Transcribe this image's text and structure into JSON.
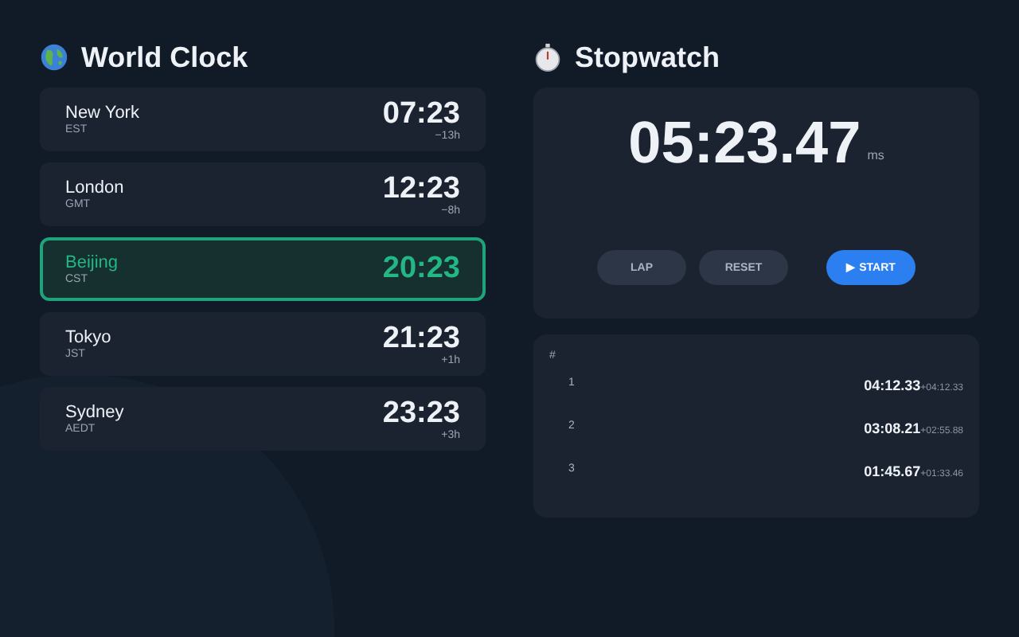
{
  "world_clock": {
    "title": "World Clock",
    "cities": [
      {
        "name": "New York",
        "zone": "EST",
        "time": "07:23",
        "offset": "−13h",
        "selected": false
      },
      {
        "name": "London",
        "zone": "GMT",
        "time": "12:23",
        "offset": "−8h",
        "selected": false
      },
      {
        "name": "Beijing",
        "zone": "CST",
        "time": "20:23",
        "selected": true
      },
      {
        "name": "Tokyo",
        "zone": "JST",
        "time": "21:23",
        "offset": "+1h",
        "selected": false
      },
      {
        "name": "Sydney",
        "zone": "AEDT",
        "time": "23:23",
        "offset": "+3h",
        "selected": false
      }
    ]
  },
  "stopwatch": {
    "title": "Stopwatch",
    "time": "05:23.47",
    "unit": "ms",
    "buttons": [
      {
        "label": "LAP",
        "kind": "secondary"
      },
      {
        "label": "RESET",
        "kind": "secondary"
      },
      {
        "label": "START",
        "kind": "primary",
        "icon": "▶"
      }
    ]
  },
  "laps": {
    "header": "#",
    "rows": [
      {
        "number": "1",
        "time": "04:12.33",
        "delta": "+04:12.33"
      },
      {
        "number": "2",
        "time": "03:08.21",
        "delta": "+02:55.88"
      },
      {
        "number": "3",
        "time": "01:45.67",
        "delta": "+01:33.46"
      }
    ]
  }
}
